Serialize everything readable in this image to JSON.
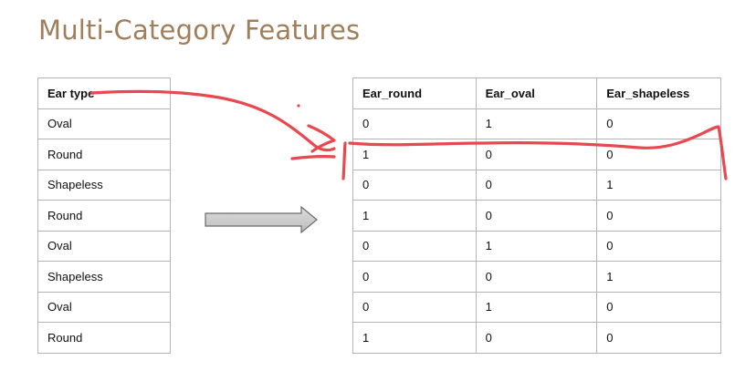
{
  "title": "Multi-Category Features",
  "left_table": {
    "header": "Ear type",
    "rows": [
      "Oval",
      "Round",
      "Shapeless",
      "Round",
      "Oval",
      "Shapeless",
      "Oval",
      "Round"
    ]
  },
  "right_table": {
    "headers": [
      "Ear_round",
      "Ear_oval",
      "Ear_shapeless"
    ],
    "rows": [
      [
        "0",
        "1",
        "0"
      ],
      [
        "1",
        "0",
        "0"
      ],
      [
        "0",
        "0",
        "1"
      ],
      [
        "1",
        "0",
        "0"
      ],
      [
        "0",
        "1",
        "0"
      ],
      [
        "0",
        "0",
        "1"
      ],
      [
        "0",
        "1",
        "0"
      ],
      [
        "1",
        "0",
        "0"
      ]
    ]
  },
  "arrow_icon": "right-arrow-icon",
  "annotation_color": "#e8484f",
  "title_color": "#a07e5a"
}
